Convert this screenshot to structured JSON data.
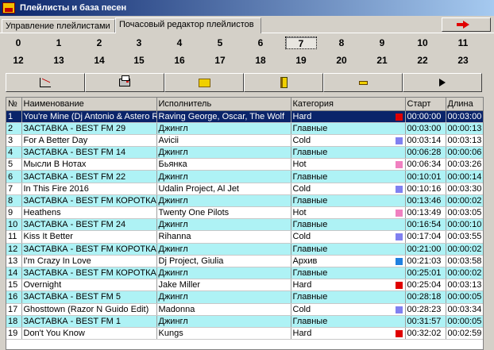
{
  "window": {
    "title": "Плейлисты и база песен"
  },
  "tabs": [
    {
      "label": "Управление плейлистами"
    },
    {
      "label": "Почасовый редактор плейлистов"
    }
  ],
  "hours_row1": [
    "0",
    "1",
    "2",
    "3",
    "4",
    "5",
    "6",
    "7",
    "8",
    "9",
    "10",
    "11"
  ],
  "hours_row2": [
    "12",
    "13",
    "14",
    "15",
    "16",
    "17",
    "18",
    "19",
    "20",
    "21",
    "22",
    "23"
  ],
  "selected_hour": "7",
  "toolbar": {
    "icons": [
      "chart-icon",
      "printer-icon",
      "folder-icon",
      "book-icon",
      "minus-icon",
      "play-icon"
    ]
  },
  "colors": {
    "hard": "#e00000",
    "cold": "#8080f0",
    "hot": "#f080c0",
    "archive": "#2080e0",
    "row_alt": "#aef2f5",
    "selection": "#0a246a"
  },
  "table": {
    "headers": [
      "№",
      "Наименование",
      "Исполнитель",
      "Категория",
      "Старт",
      "Длина"
    ],
    "rows": [
      {
        "n": "1",
        "name": "You're Mine (Dj Antonio & Astero R",
        "artist": "Raving George, Oscar, The Wolf",
        "cat": "Hard",
        "start": "00:00:00",
        "len": "00:03:00",
        "swatch": "hard"
      },
      {
        "n": "2",
        "name": "ЗАСТАВКА - BEST FM 29",
        "artist": "Джингл",
        "cat": "Главные",
        "start": "00:03:00",
        "len": "00:00:13",
        "swatch": ""
      },
      {
        "n": "3",
        "name": "For A Better Day",
        "artist": "Avicii",
        "cat": "Cold",
        "start": "00:03:14",
        "len": "00:03:13",
        "swatch": "cold"
      },
      {
        "n": "4",
        "name": "ЗАСТАВКА - BEST FM 14",
        "artist": "Джингл",
        "cat": "Главные",
        "start": "00:06:28",
        "len": "00:00:06",
        "swatch": ""
      },
      {
        "n": "5",
        "name": "Мысли В Нотах",
        "artist": "Бьянка",
        "cat": "Hot",
        "start": "00:06:34",
        "len": "00:03:26",
        "swatch": "hot"
      },
      {
        "n": "6",
        "name": "ЗАСТАВКА - BEST FM 22",
        "artist": "Джингл",
        "cat": "Главные",
        "start": "00:10:01",
        "len": "00:00:14",
        "swatch": ""
      },
      {
        "n": "7",
        "name": "In This Fire 2016",
        "artist": "Udalin Project, Al Jet",
        "cat": "Cold",
        "start": "00:10:16",
        "len": "00:03:30",
        "swatch": "cold"
      },
      {
        "n": "8",
        "name": "ЗАСТАВКА - BEST FM КОРОТКА",
        "artist": "Джингл",
        "cat": "Главные",
        "start": "00:13:46",
        "len": "00:00:02",
        "swatch": ""
      },
      {
        "n": "9",
        "name": "Heathens",
        "artist": "Twenty One Pilots",
        "cat": "Hot",
        "start": "00:13:49",
        "len": "00:03:05",
        "swatch": "hot"
      },
      {
        "n": "10",
        "name": "ЗАСТАВКА - BEST FM 24",
        "artist": "Джингл",
        "cat": "Главные",
        "start": "00:16:54",
        "len": "00:00:10",
        "swatch": ""
      },
      {
        "n": "11",
        "name": "Kiss It Better",
        "artist": "Rihanna",
        "cat": "Cold",
        "start": "00:17:04",
        "len": "00:03:55",
        "swatch": "cold"
      },
      {
        "n": "12",
        "name": "ЗАСТАВКА - BEST FM КОРОТКА",
        "artist": "Джингл",
        "cat": "Главные",
        "start": "00:21:00",
        "len": "00:00:02",
        "swatch": ""
      },
      {
        "n": "13",
        "name": "I'm Crazy In Love",
        "artist": "Dj Project, Giulia",
        "cat": "Архив",
        "start": "00:21:03",
        "len": "00:03:58",
        "swatch": "archive"
      },
      {
        "n": "14",
        "name": "ЗАСТАВКА - BEST FM КОРОТКА",
        "artist": "Джингл",
        "cat": "Главные",
        "start": "00:25:01",
        "len": "00:00:02",
        "swatch": ""
      },
      {
        "n": "15",
        "name": "Overnight",
        "artist": "Jake Miller",
        "cat": "Hard",
        "start": "00:25:04",
        "len": "00:03:13",
        "swatch": "hard"
      },
      {
        "n": "16",
        "name": "ЗАСТАВКА - BEST FM 5",
        "artist": "Джингл",
        "cat": "Главные",
        "start": "00:28:18",
        "len": "00:00:05",
        "swatch": ""
      },
      {
        "n": "17",
        "name": "Ghosttown (Razor N Guido Edit)",
        "artist": "Madonna",
        "cat": "Cold",
        "start": "00:28:23",
        "len": "00:03:34",
        "swatch": "cold"
      },
      {
        "n": "18",
        "name": "ЗАСТАВКА - BEST FM 1",
        "artist": "Джингл",
        "cat": "Главные",
        "start": "00:31:57",
        "len": "00:00:05",
        "swatch": ""
      },
      {
        "n": "19",
        "name": "Don't You Know",
        "artist": "Kungs",
        "cat": "Hard",
        "start": "00:32:02",
        "len": "00:02:59",
        "swatch": "hard"
      }
    ]
  }
}
